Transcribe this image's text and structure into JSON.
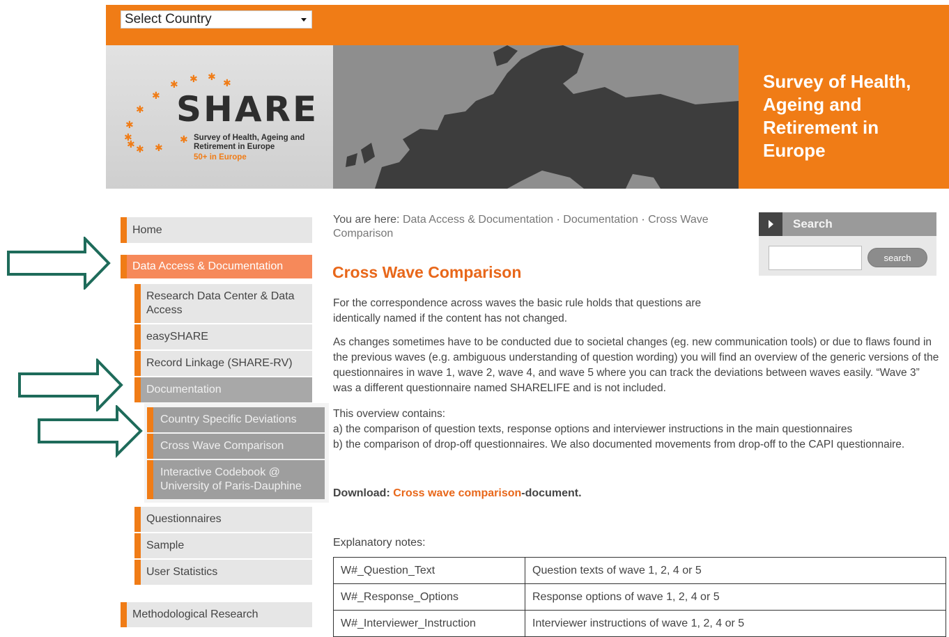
{
  "header": {
    "country_select": "Select Country",
    "logo_word": "SHARE",
    "logo_subtitle": "Survey of Health, Ageing and Retirement in Europe",
    "logo_tagline": "50+ in Europe",
    "banner_title": "Survey of Health, Ageing and Retirement in Europe"
  },
  "sidebar": {
    "home": "Home",
    "data_access": "Data Access & Documentation",
    "research_center": "Research Data Center & Data Access",
    "easyshare": "easySHARE",
    "record_linkage": "Record Linkage (SHARE-RV)",
    "documentation": "Documentation",
    "country_deviations": "Country Specific Deviations",
    "cross_wave": "Cross Wave Comparison",
    "interactive_codebook": "Interactive Codebook @ University of Paris-Dauphine",
    "questionnaires": "Questionnaires",
    "sample": "Sample",
    "user_statistics": "User Statistics",
    "methodological": "Methodological Research"
  },
  "breadcrumb": {
    "prefix": "You are here: ",
    "items": [
      "Data Access & Documentation",
      "Documentation",
      "Cross Wave Comparison"
    ],
    "sep": " · "
  },
  "main": {
    "title": "Cross Wave Comparison",
    "para1": "For the correspondence across waves the basic rule holds that questions are identically named if the content has not changed.",
    "para2": "As changes sometimes have to be conducted due to societal changes (eg. new communication tools) or due to flaws found in the previous waves (e.g. ambiguous understanding of question wording) you will find an overview of the generic versions of the questionnaires in wave 1, wave 2, wave 4, and wave 5 where you can track the deviations between waves easily. “Wave 3” was a different questionnaire named SHARELIFE and is not included.",
    "para3_intro": "This overview contains:",
    "para3_a": "a) the comparison of question texts, response options and interviewer instructions in the main questionnaires",
    "para3_b": "b) the comparison of drop-off questionnaires. We also documented movements from drop-off to the CAPI questionnaire.",
    "download_prefix": "Download: ",
    "download_link": "Cross wave comparison",
    "download_suffix": "-document.",
    "explanatory": "Explanatory notes:",
    "notes": [
      {
        "key": "W#_Question_Text",
        "value": "Question texts of wave 1, 2, 4 or 5"
      },
      {
        "key": "W#_Response_Options",
        "value": "Response options of wave 1, 2, 4 or 5"
      },
      {
        "key": "W#_Interviewer_Instruction",
        "value": "Interviewer instructions of wave 1, 2, 4 or 5"
      }
    ]
  },
  "search": {
    "heading": "Search",
    "button": "search",
    "value": ""
  },
  "colors": {
    "accent": "#f07c16",
    "link": "#e8671a",
    "arrow": "#1e6b5a"
  }
}
